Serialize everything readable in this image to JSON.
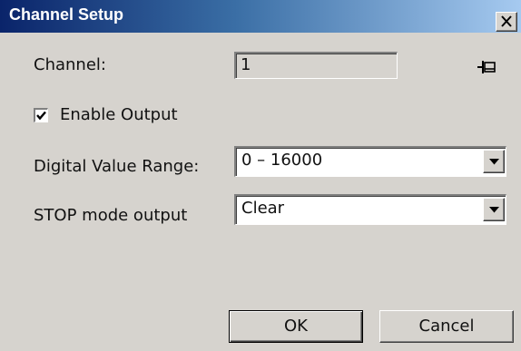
{
  "window": {
    "title": "Channel Setup",
    "close_glyph": "✕",
    "titlebar_color": "#0a246a",
    "face_color": "#d6d3ce"
  },
  "channel": {
    "label": "Channel:",
    "value": "1",
    "pin_icon": "pin-icon"
  },
  "enable_output": {
    "label": "Enable Output",
    "checked": true
  },
  "digital_range": {
    "label": "Digital Value Range:",
    "selected": "0 – 16000"
  },
  "stop_mode": {
    "label": "STOP mode output",
    "selected": "Clear"
  },
  "buttons": {
    "ok_label": "OK",
    "cancel_label": "Cancel"
  }
}
